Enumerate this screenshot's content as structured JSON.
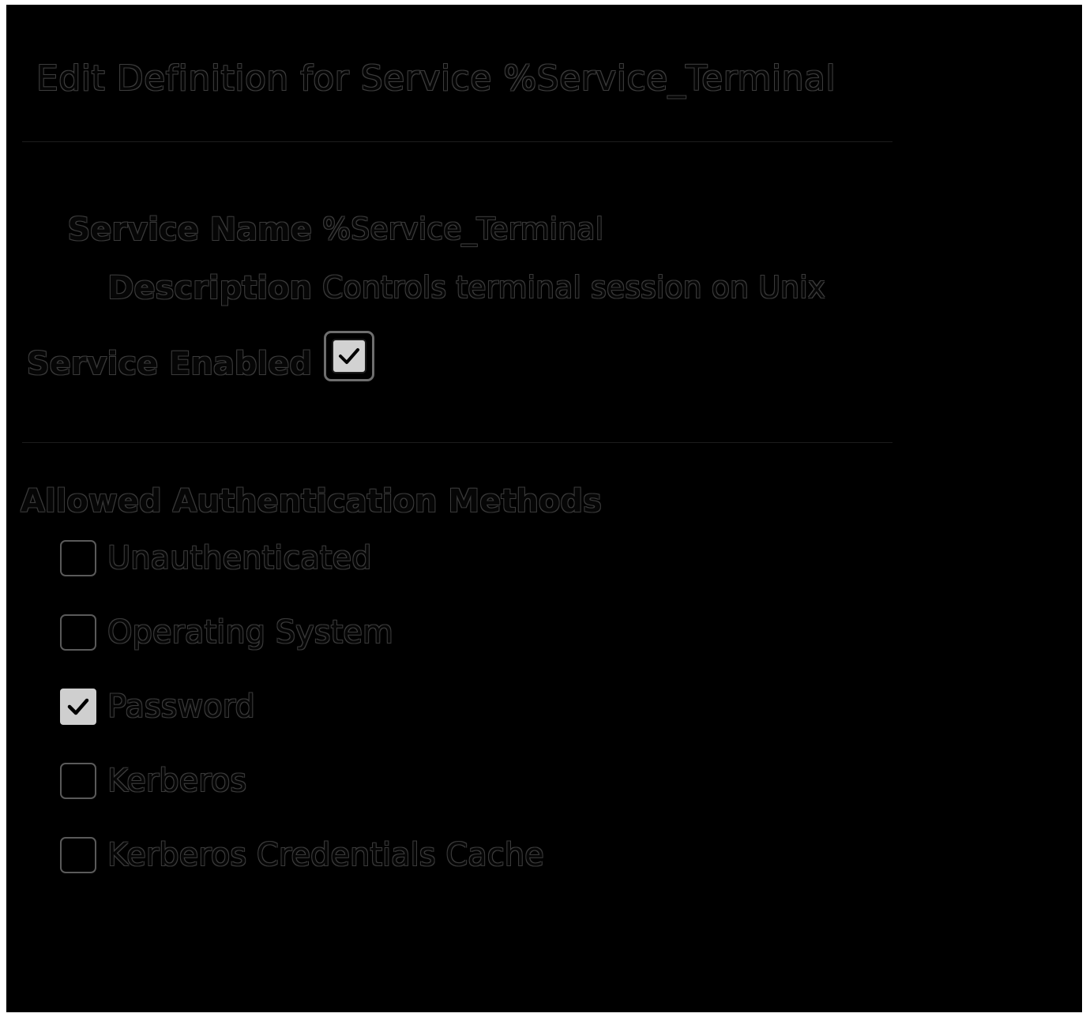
{
  "page": {
    "title": "Edit Definition for Service %Service_Terminal"
  },
  "service": {
    "name_label": "Service Name",
    "name_value": "%Service_Terminal",
    "description_label": "Description",
    "description_value": "Controls terminal session on Unix",
    "enabled_label": "Service Enabled",
    "enabled": true
  },
  "auth": {
    "heading": "Allowed Authentication Methods",
    "methods": [
      {
        "label": "Unauthenticated",
        "checked": false
      },
      {
        "label": "Operating System",
        "checked": false
      },
      {
        "label": "Password",
        "checked": true
      },
      {
        "label": "Kerberos",
        "checked": false
      },
      {
        "label": "Kerberos Credentials Cache",
        "checked": false
      }
    ]
  },
  "icons": {
    "checkmark": "check-icon"
  },
  "colors": {
    "background": "#000000",
    "text_outline": "#3a3a3a",
    "checkbox_fill": "#cfcfcf",
    "checkbox_border": "#5a5a5a"
  }
}
